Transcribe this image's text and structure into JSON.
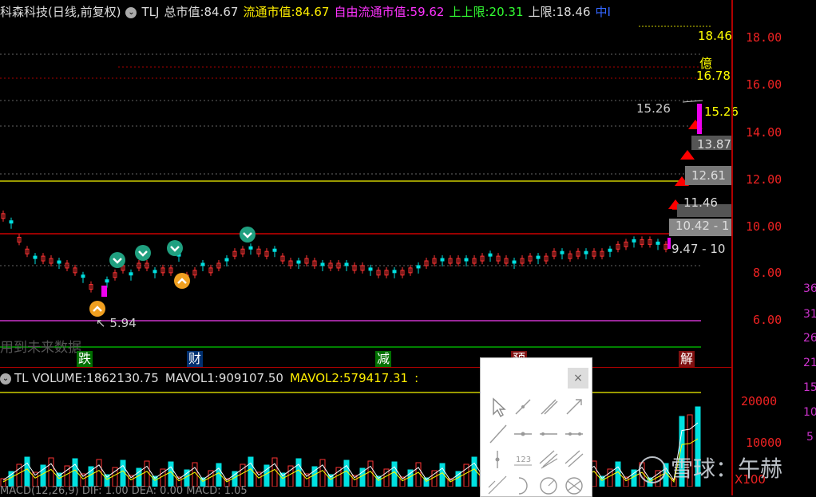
{
  "header": {
    "stock_name": "科森科技(日线,前复权)",
    "code": "TLJ",
    "total_mv_label": "总市值:",
    "total_mv": "84.67",
    "float_mv_label": "流通市值:",
    "float_mv": "84.67",
    "free_mv_label": "自由流通市值:",
    "free_mv": "59.62",
    "up_limit_label": "上上限:",
    "up_limit": "20.31",
    "limit_label": "上限:",
    "limit": "18.46",
    "cut_text": "中I"
  },
  "price_axis": {
    "ticks": [
      "18.00",
      "16.00",
      "14.00",
      "12.00",
      "10.00",
      "8.00",
      "6.00"
    ]
  },
  "right_cut_labels": [
    "36",
    "31",
    "26",
    "21",
    "15",
    "10",
    "5"
  ],
  "annotations": {
    "a1846": "18.46",
    "yi": "億",
    "a1678": "16.78",
    "a1526l": "15.26",
    "a1526r": "15.26",
    "a1387": "13.87",
    "a1261": "12.61",
    "a1146": "11.46",
    "a1042": "10.42 - 1",
    "a947": "9.47 - 10",
    "low": "5.94",
    "future": "用到未来数据"
  },
  "events": [
    "跌",
    "财",
    "减",
    "预",
    "解"
  ],
  "volume": {
    "label": "TL VOLUME:",
    "vol": "1862130.75",
    "mavol1_label": "MAVOL1:",
    "mavol1": "909107.50",
    "mavol2_label": "MAVOL2:",
    "mavol2": "579417.31",
    "cut": ":",
    "ticks": [
      "20000",
      "10000"
    ],
    "unit": "X100"
  },
  "macd_cut": "MACD(12,26,9) DIF: 1.00 DEA: 0.00 MACD: 1.05",
  "watermark": "雪球：午赫",
  "colors": {
    "up": "#ff3333",
    "down": "#00e0e0",
    "ma5": "#ffffff",
    "ma10": "#ffff00",
    "limit": "#cc33cc"
  }
}
